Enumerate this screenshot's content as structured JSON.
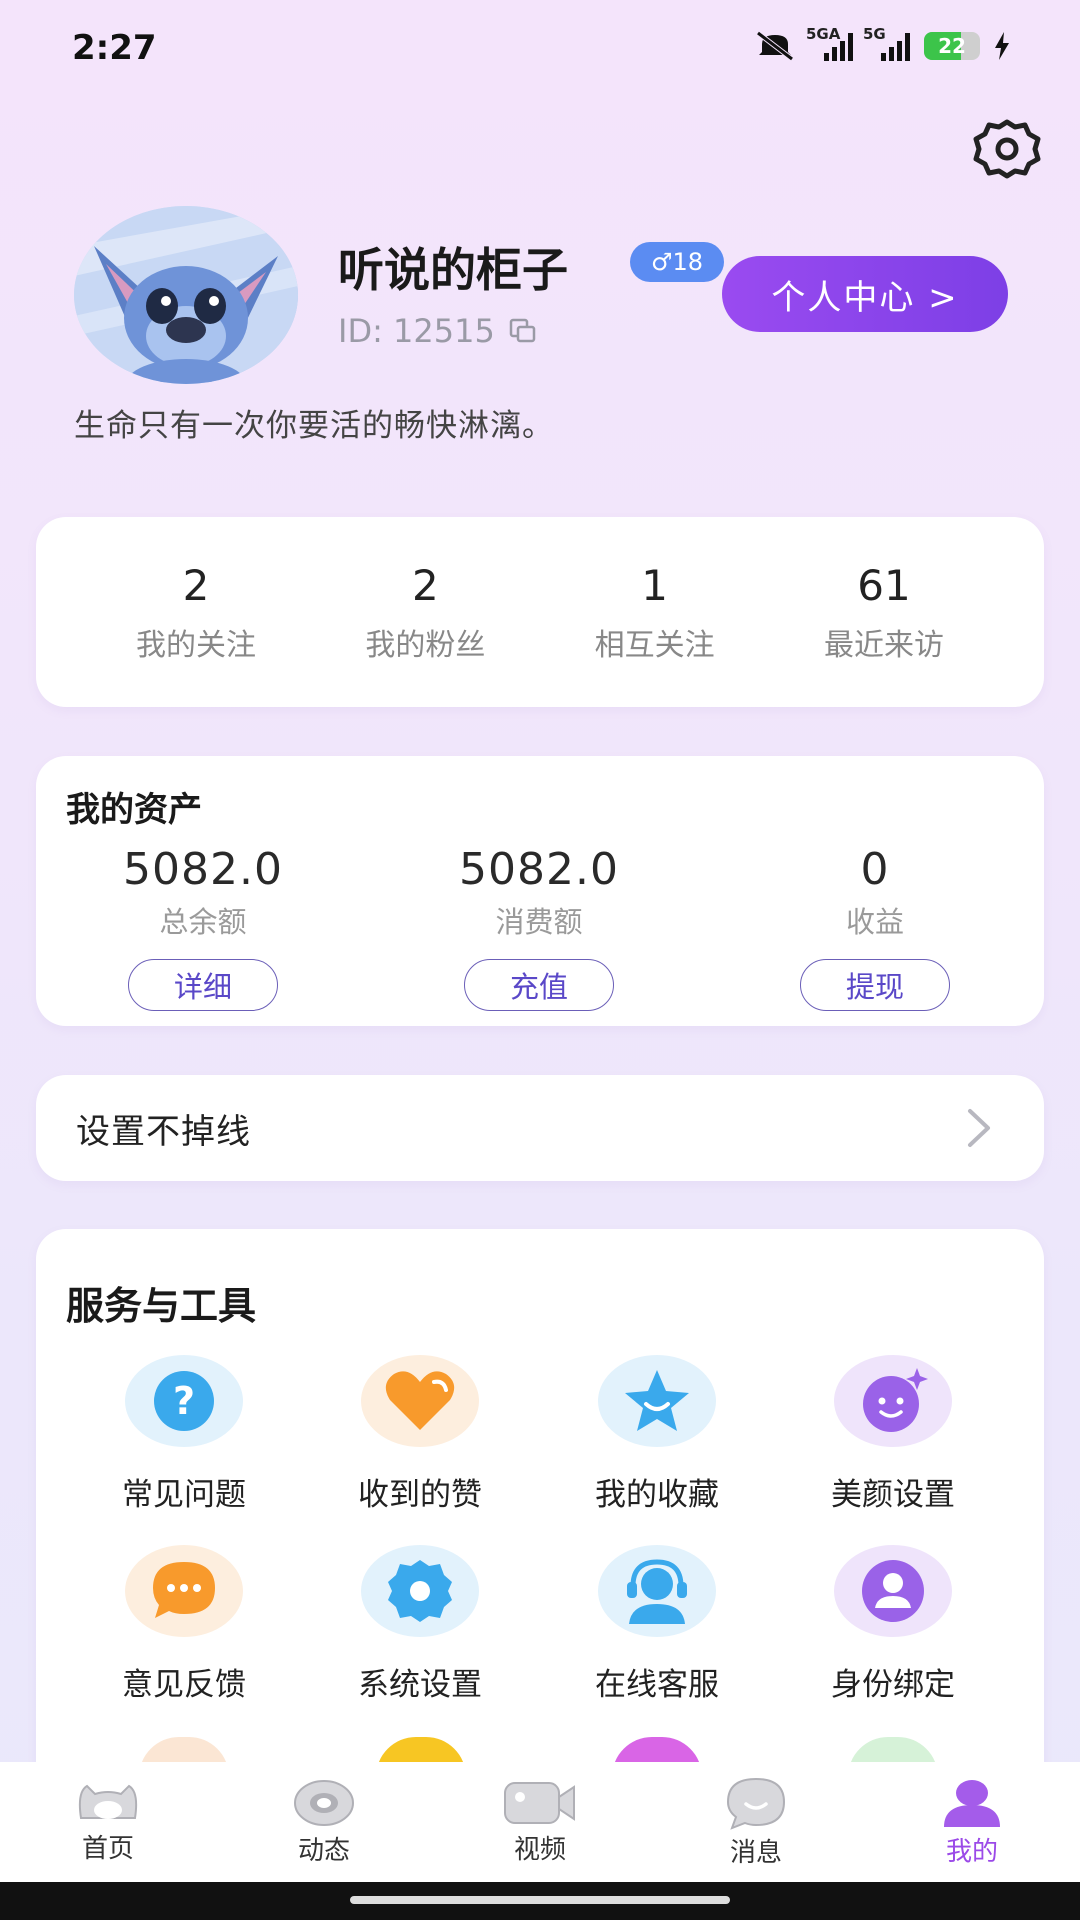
{
  "status": {
    "time": "2:27",
    "net1": "5GA",
    "net2": "5G",
    "battery": "22"
  },
  "profile": {
    "name": "听说的柜子",
    "gender_age": "♂18",
    "id_text": "ID: 12515",
    "center_button": "个人中心 >",
    "bio": "生命只有一次你要活的畅快淋漓。"
  },
  "stats": [
    {
      "value": "2",
      "label": "我的关注"
    },
    {
      "value": "2",
      "label": "我的粉丝"
    },
    {
      "value": "1",
      "label": "相互关注"
    },
    {
      "value": "61",
      "label": "最近来访"
    }
  ],
  "assets": {
    "title": "我的资产",
    "items": [
      {
        "value": "5082.0",
        "label": "总余额",
        "button": "详细"
      },
      {
        "value": "5082.0",
        "label": "消费额",
        "button": "充值"
      },
      {
        "value": "0",
        "label": "收益",
        "button": "提现"
      }
    ]
  },
  "online": {
    "label": "设置不掉线"
  },
  "tools": {
    "title": "服务与工具",
    "items": [
      {
        "label": "常见问题",
        "icon": "question-icon"
      },
      {
        "label": "收到的赞",
        "icon": "heart-icon"
      },
      {
        "label": "我的收藏",
        "icon": "star-icon"
      },
      {
        "label": "美颜设置",
        "icon": "beauty-icon"
      },
      {
        "label": "意见反馈",
        "icon": "feedback-icon"
      },
      {
        "label": "系统设置",
        "icon": "gear-icon"
      },
      {
        "label": "在线客服",
        "icon": "headset-icon"
      },
      {
        "label": "身份绑定",
        "icon": "person-icon"
      }
    ]
  },
  "tabs": [
    {
      "label": "首页",
      "icon": "home-icon"
    },
    {
      "label": "动态",
      "icon": "eye-icon"
    },
    {
      "label": "视频",
      "icon": "video-icon"
    },
    {
      "label": "消息",
      "icon": "chat-icon"
    },
    {
      "label": "我的",
      "icon": "profile-icon",
      "active": true
    }
  ],
  "colors": {
    "accent": "#9b4ae8",
    "badge": "#5b8cf2",
    "button_outline": "#6b5fb8"
  }
}
